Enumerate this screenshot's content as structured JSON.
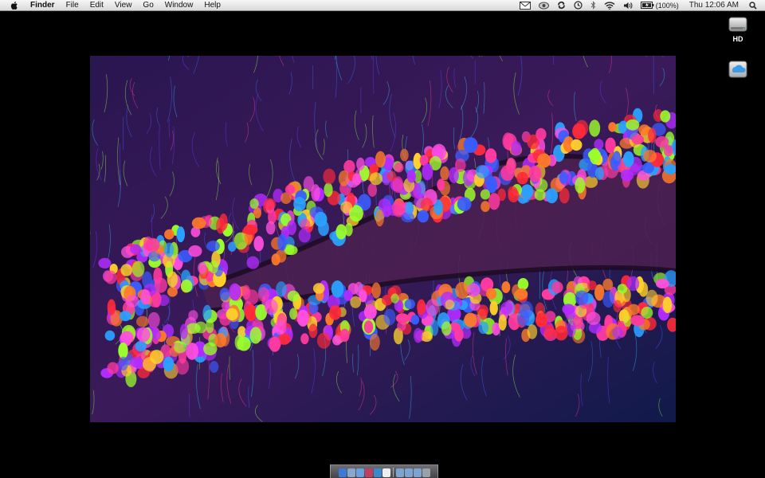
{
  "menubar": {
    "apple_icon": "apple-logo-icon",
    "app_name": "Finder",
    "menus": [
      "File",
      "Edit",
      "View",
      "Go",
      "Window",
      "Help"
    ],
    "status_icons": [
      "mail-icon",
      "eye-icon",
      "sync-icon",
      "time-machine-icon",
      "bluetooth-icon",
      "wifi-icon",
      "volume-icon",
      "battery-icon"
    ],
    "battery_percent": "(100%)",
    "clock": "Thu 12:06 AM",
    "spotlight_icon": "spotlight-search-icon"
  },
  "desktop": {
    "icons": [
      {
        "label": "HD",
        "icon": "hard-drive-icon"
      },
      {
        "label": "",
        "icon": "idisk-icon"
      }
    ]
  },
  "dock": {
    "items": [
      "finder-icon",
      "mail-app-icon",
      "safari-icon",
      "itunes-icon",
      "app-store-icon",
      "x11-icon",
      "folder-icon",
      "folder-icon",
      "folder-icon",
      "trash-icon"
    ],
    "colors": [
      "#3b7bd8",
      "#8aa6c8",
      "#6aa0e0",
      "#c04060",
      "#3a8ad0",
      "#eeeeee",
      "#7da4d0",
      "#7da4d0",
      "#7da4d0",
      "#9aa0a8"
    ]
  },
  "wallpaper": {
    "subject": "microscopy-neurons-image",
    "colors": [
      "#ff2a3a",
      "#ff3aa0",
      "#b22cff",
      "#3a5cff",
      "#2aa0ff",
      "#9cff2a",
      "#ffd02a",
      "#ff7a2a",
      "#ff4fe0"
    ]
  }
}
